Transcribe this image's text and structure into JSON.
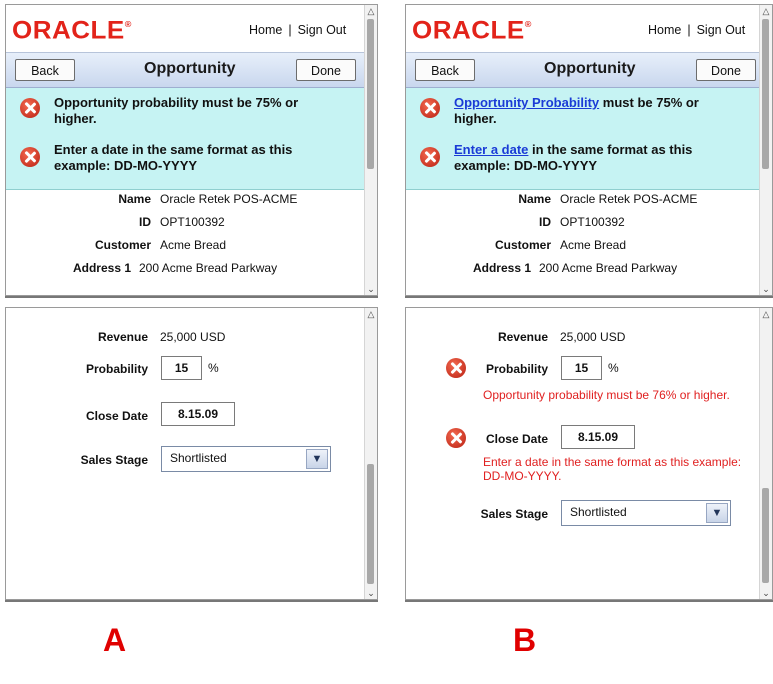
{
  "brand": {
    "logo": "ORACLE",
    "trademark": "®",
    "brand_color": "#e2231a"
  },
  "header": {
    "home_label": "Home",
    "separator": "|",
    "signout_label": "Sign Out"
  },
  "navbar": {
    "back_label": "Back",
    "title": "Opportunity",
    "done_label": "Done"
  },
  "details": {
    "name_label": "Name",
    "name_value": "Oracle Retek POS-ACME",
    "id_label": "ID",
    "id_value": "OPT100392",
    "customer_label": "Customer",
    "customer_value": "Acme Bread",
    "address_label": "Address 1",
    "address_value": "200 Acme Bread Parkway"
  },
  "form": {
    "revenue_label": "Revenue",
    "revenue_value": "25,000 USD",
    "probability_label": "Probability",
    "probability_value": "15",
    "probability_unit": "%",
    "close_date_label": "Close Date",
    "close_date_value": "8.15.09",
    "sales_stage_label": "Sales Stage",
    "sales_stage_value": "Shortlisted"
  },
  "variant_a": {
    "caption": "A",
    "errors": [
      {
        "line1": "Opportunity probability must be 75% or",
        "line2": "higher."
      },
      {
        "line1": "Enter a date in the same format as this",
        "line2": "example: DD-MO-YYYY"
      }
    ]
  },
  "variant_b": {
    "caption": "B",
    "errors": [
      {
        "link": "Opportunity Probability",
        "rest": " must be 75% or",
        "line2": "higher."
      },
      {
        "link": "Enter a date",
        "rest": " in the same format as this",
        "line2": "example: DD-MO-YYYY"
      }
    ],
    "probability_inline_error": "Opportunity probability must be 76% or higher.",
    "date_inline_error_line1": "Enter a date in the same format as this example:",
    "date_inline_error_line2": "DD-MO-YYYY."
  },
  "colors": {
    "error_bg": "#c6f3f3",
    "link": "#1a3bd6",
    "inline_error": "#e02020",
    "caption": "#e00000"
  },
  "icons": [
    "error-icon",
    "chevron-down-icon",
    "scroll-up-arrow",
    "scroll-down-arrow"
  ]
}
